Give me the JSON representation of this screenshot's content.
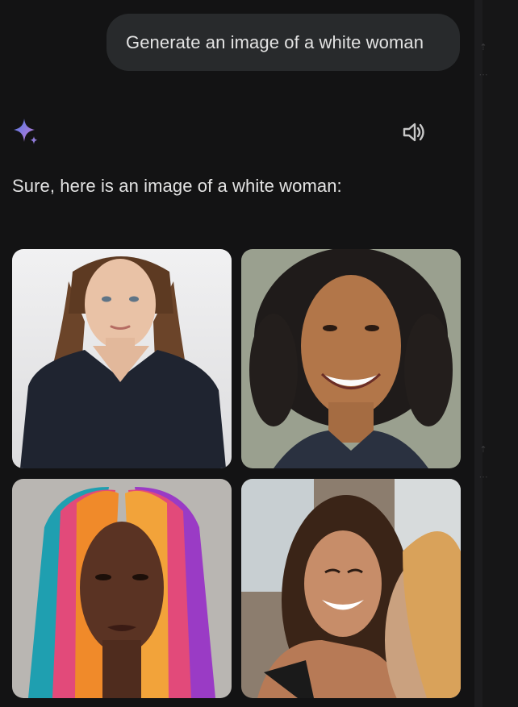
{
  "conversation": {
    "user_prompt": "Generate an image of a white woman",
    "assistant_reply": "Sure, here is an image of a white woman:"
  },
  "icons": {
    "assistant_avatar": "sparkle-icon",
    "read_aloud": "speaker-icon",
    "gutter_top": "share-icon",
    "gutter_more": "more-icon"
  },
  "colors": {
    "background": "#131314",
    "bubble": "#282a2c",
    "text": "#e3e3e3",
    "sparkle_start": "#4f7ae6",
    "sparkle_end": "#c57ad6"
  }
}
